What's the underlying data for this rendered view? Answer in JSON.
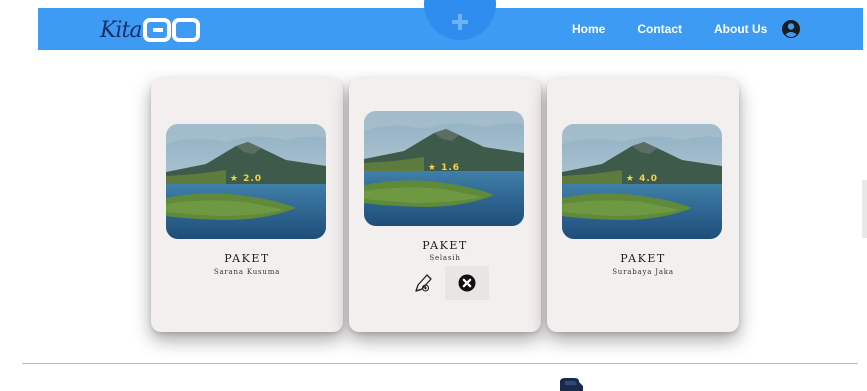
{
  "brand": {
    "script": "Kita",
    "mark": "GO"
  },
  "nav": {
    "links": [
      "Home",
      "Contact",
      "About Us"
    ],
    "user_icon": "user-circle-icon",
    "fab_icon": "plus-icon"
  },
  "cards": [
    {
      "rating": "★ 2.0",
      "title": "PAKET",
      "subtitle": "Sarana Kusuma"
    },
    {
      "rating": "★ 1.6",
      "title": "PAKET",
      "subtitle": "Selasih",
      "actions": [
        "edit-icon",
        "delete-icon"
      ]
    },
    {
      "rating": "★ 4.0",
      "title": "PAKET",
      "subtitle": "Surabaya Jaka"
    }
  ],
  "colors": {
    "navbar": "#3d9bf3",
    "card_bg": "#f4efef",
    "rating": "#f5d34a"
  }
}
